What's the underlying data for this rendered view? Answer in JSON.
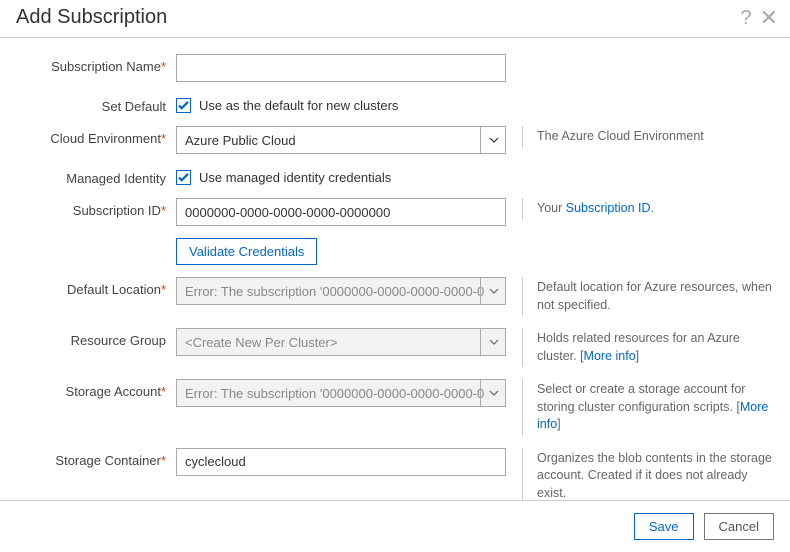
{
  "dialog": {
    "title": "Add Subscription"
  },
  "fields": {
    "subscriptionName": {
      "label": "Subscription Name",
      "value": ""
    },
    "setDefault": {
      "label": "Set Default",
      "checkboxLabel": "Use as the default for new clusters"
    },
    "cloudEnv": {
      "label": "Cloud Environment",
      "value": "Azure Public Cloud",
      "hint": "The Azure Cloud Environment"
    },
    "managedIdentity": {
      "label": "Managed Identity",
      "checkboxLabel": "Use managed identity credentials"
    },
    "subscriptionId": {
      "label": "Subscription ID",
      "value": "0000000-0000-0000-0000-0000000",
      "hintPrefix": "Your ",
      "hintLink": "Subscription ID"
    },
    "validateBtn": "Validate Credentials",
    "defaultLocation": {
      "label": "Default Location",
      "value": "Error: The subscription '0000000-0000-0000-0000-0",
      "hint": "Default location for Azure resources, when not specified."
    },
    "resourceGroup": {
      "label": "Resource Group",
      "value": "<Create New Per Cluster>",
      "hintPrefix": "Holds related resources for an Azure cluster. [",
      "hintLink": "More info",
      "hintSuffix": "]"
    },
    "storageAccount": {
      "label": "Storage Account",
      "value": "Error: The subscription '0000000-0000-0000-0000-0",
      "hintPrefix": "Select or create a storage account for storing cluster configuration scripts. [",
      "hintLink": "More info",
      "hintSuffix": "]"
    },
    "storageContainer": {
      "label": "Storage Container",
      "value": "cyclecloud",
      "hint": "Organizes the blob contents in the storage account. Created if it does not already exist."
    }
  },
  "footer": {
    "save": "Save",
    "cancel": "Cancel"
  }
}
